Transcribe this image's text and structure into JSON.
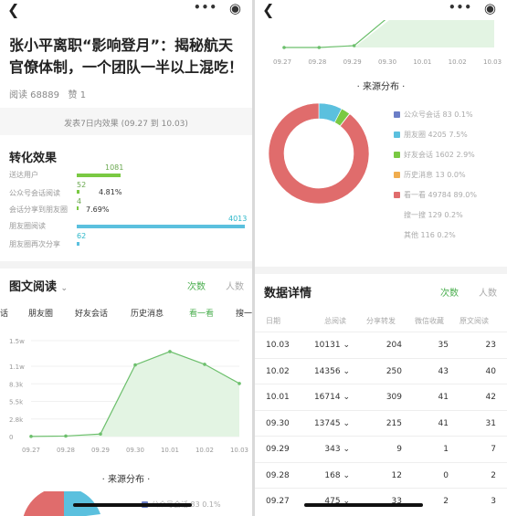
{
  "left": {
    "back_icon": "chevron-left-icon",
    "more_icon": "more-dots-icon",
    "target_icon": "target-circle-icon",
    "article_title": "张小平离职“影响登月”：揭秘航天官僚体制，一个团队一半以上混吃！",
    "reads": "阅读 68889",
    "likes": "赞 1",
    "effect_range": "发表7日内效果 (09.27 到 10.03)",
    "conversion_title": "转化效果",
    "conversion": [
      {
        "label": "送达用户",
        "value": "1081"
      },
      {
        "label": "公众号会话阅读",
        "value": "52",
        "rate": "4.81%"
      },
      {
        "label": "会话分享到朋友圈",
        "value": "4",
        "rate": "7.69%"
      },
      {
        "label": "朋友圈阅读",
        "value": "4013"
      },
      {
        "label": "朋友圈再次分享",
        "value": "62"
      }
    ],
    "reading_title": "图文阅读",
    "reading_dropdown_icon": "chevron-down-icon",
    "tabs": {
      "count": "次数",
      "people": "人数"
    },
    "sources": [
      "话",
      "朋友圈",
      "好友会话",
      "历史消息",
      "看一看",
      "搜一"
    ],
    "source_footer": "来源分布",
    "legend_peek": "公众号会话 83 0.1%"
  },
  "chart_data": {
    "type": "area",
    "x": [
      "09.27",
      "09.28",
      "09.29",
      "09.30",
      "10.01",
      "10.02",
      "10.03"
    ],
    "values": [
      20,
      80,
      400,
      11200,
      13300,
      11300,
      8300
    ],
    "yticks": [
      "0",
      "2.8k",
      "5.5k",
      "8.3k",
      "1.1w",
      "1.5w"
    ],
    "ylim": [
      0,
      15000
    ],
    "color": "#6cbf6c",
    "fill": "#e3f4e3"
  },
  "right": {
    "back_icon": "chevron-left-icon",
    "xaxis": [
      "09.27",
      "09.28",
      "09.29",
      "09.30",
      "10.01",
      "10.02",
      "10.03"
    ],
    "source_title": "来源分布",
    "pie": [
      {
        "label": "公众号会话",
        "value": "83",
        "pct": "0.1%",
        "color": "#6b7ec7",
        "frac": 0.001
      },
      {
        "label": "朋友圈",
        "value": "4205",
        "pct": "7.5%",
        "color": "#5bc0de",
        "frac": 0.075
      },
      {
        "label": "好友会话",
        "value": "1602",
        "pct": "2.9%",
        "color": "#7ac943",
        "frac": 0.029
      },
      {
        "label": "历史消息",
        "value": "13",
        "pct": "0.0%",
        "color": "#f0ad4e",
        "frac": 0.0
      },
      {
        "label": "看一看",
        "value": "49784",
        "pct": "89.0%",
        "color": "#e06c6c",
        "frac": 0.89
      },
      {
        "label": "搜一搜",
        "value": "129",
        "pct": "0.2%",
        "color": "",
        "frac": 0.002
      },
      {
        "label": "其他",
        "value": "116",
        "pct": "0.2%",
        "color": "",
        "frac": 0.002
      }
    ],
    "details_title": "数据详情",
    "tabs": {
      "count": "次数",
      "people": "人数"
    },
    "columns": [
      "日期",
      "总阅读",
      "分享转发",
      "微信收藏",
      "原文阅读"
    ],
    "rows": [
      [
        "10.03",
        "10131",
        "204",
        "35",
        "23"
      ],
      [
        "10.02",
        "14356",
        "250",
        "43",
        "40"
      ],
      [
        "10.01",
        "16714",
        "309",
        "41",
        "42"
      ],
      [
        "09.30",
        "13745",
        "215",
        "41",
        "31"
      ],
      [
        "09.29",
        "343",
        "9",
        "1",
        "7"
      ],
      [
        "09.28",
        "168",
        "12",
        "0",
        "2"
      ],
      [
        "09.27",
        "475",
        "33",
        "2",
        "3"
      ]
    ]
  }
}
